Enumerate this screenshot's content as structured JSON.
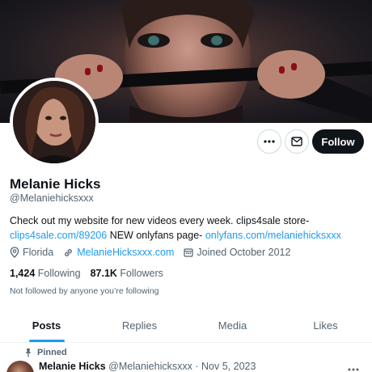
{
  "profile": {
    "name": "Melanie Hicks",
    "handle": "@Melaniehicksxxx",
    "bio_text": "Check out my website for new videos every week. clips4sale store-",
    "bio_link1": "clips4sale.com/89206",
    "bio_mid": " NEW onlyfans page- ",
    "bio_link2": "onlyfans.com/melaniehicksxxx",
    "location": "Florida",
    "website": "MelanieHicksxxx.com",
    "joined": "Joined October 2012",
    "following_count": "1,424",
    "following_label": "Following",
    "followers_count": "87.1K",
    "followers_label": "Followers",
    "not_followed": "Not followed by anyone you’re following"
  },
  "actions": {
    "more_icon": "more-horizontal-icon",
    "message_icon": "envelope-icon",
    "follow_label": "Follow"
  },
  "tabs": [
    {
      "label": "Posts",
      "active": true
    },
    {
      "label": "Replies",
      "active": false
    },
    {
      "label": "Media",
      "active": false
    },
    {
      "label": "Likes",
      "active": false
    }
  ],
  "pinned_post": {
    "pinned_label": "Pinned",
    "name": "Melanie Hicks",
    "handle": "@Melaniehicksxxx",
    "separator": "·",
    "date": "Nov 5, 2023"
  },
  "colors": {
    "accent": "#1d9bf0",
    "text": "#0f1419",
    "muted": "#536471",
    "follow_bg": "#0f1419"
  }
}
